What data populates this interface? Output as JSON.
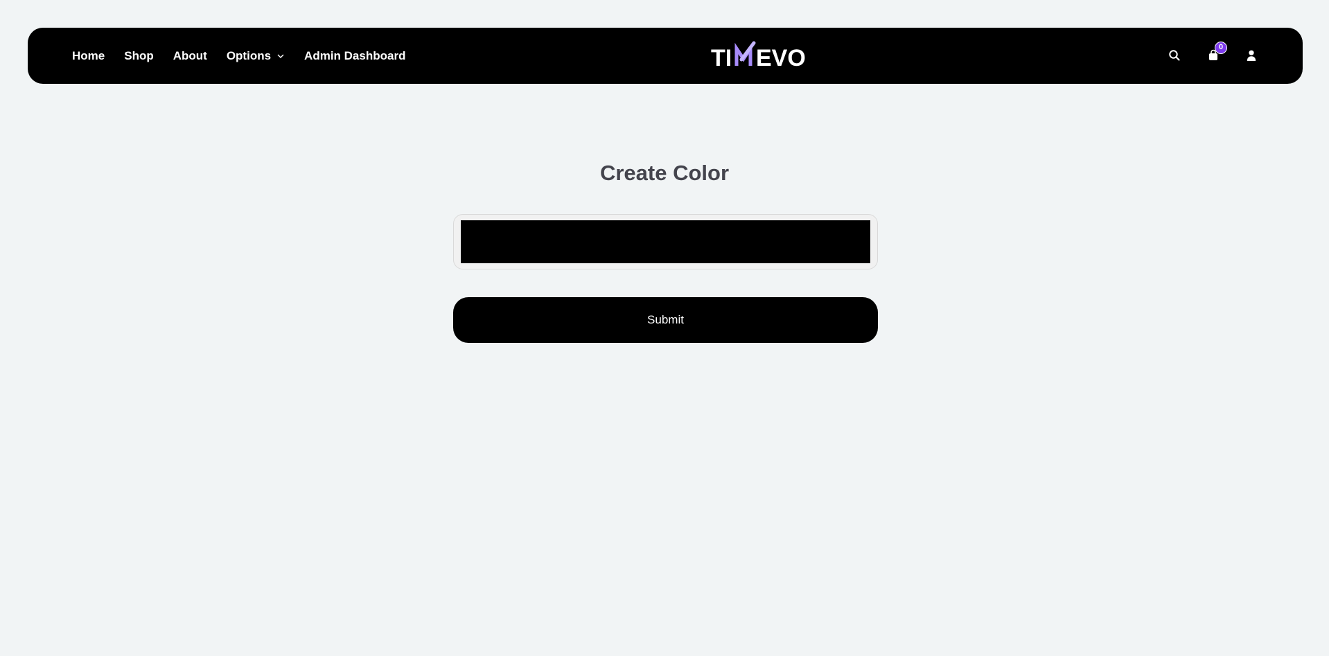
{
  "nav": {
    "links": [
      "Home",
      "Shop",
      "About",
      "Options",
      "Admin Dashboard"
    ],
    "logo_text": "TIMEVO",
    "cart_count": "0"
  },
  "form": {
    "title": "Create Color",
    "color_value": "#000000",
    "submit_label": "Submit"
  },
  "colors": {
    "background": "#f1f4f5",
    "navbar": "#000000",
    "badge": "#7c3aed",
    "title": "#44444d",
    "logo_accent": "#a78bfa"
  },
  "icons": [
    "chevron-down-icon",
    "search-icon",
    "cart-icon",
    "user-icon"
  ]
}
